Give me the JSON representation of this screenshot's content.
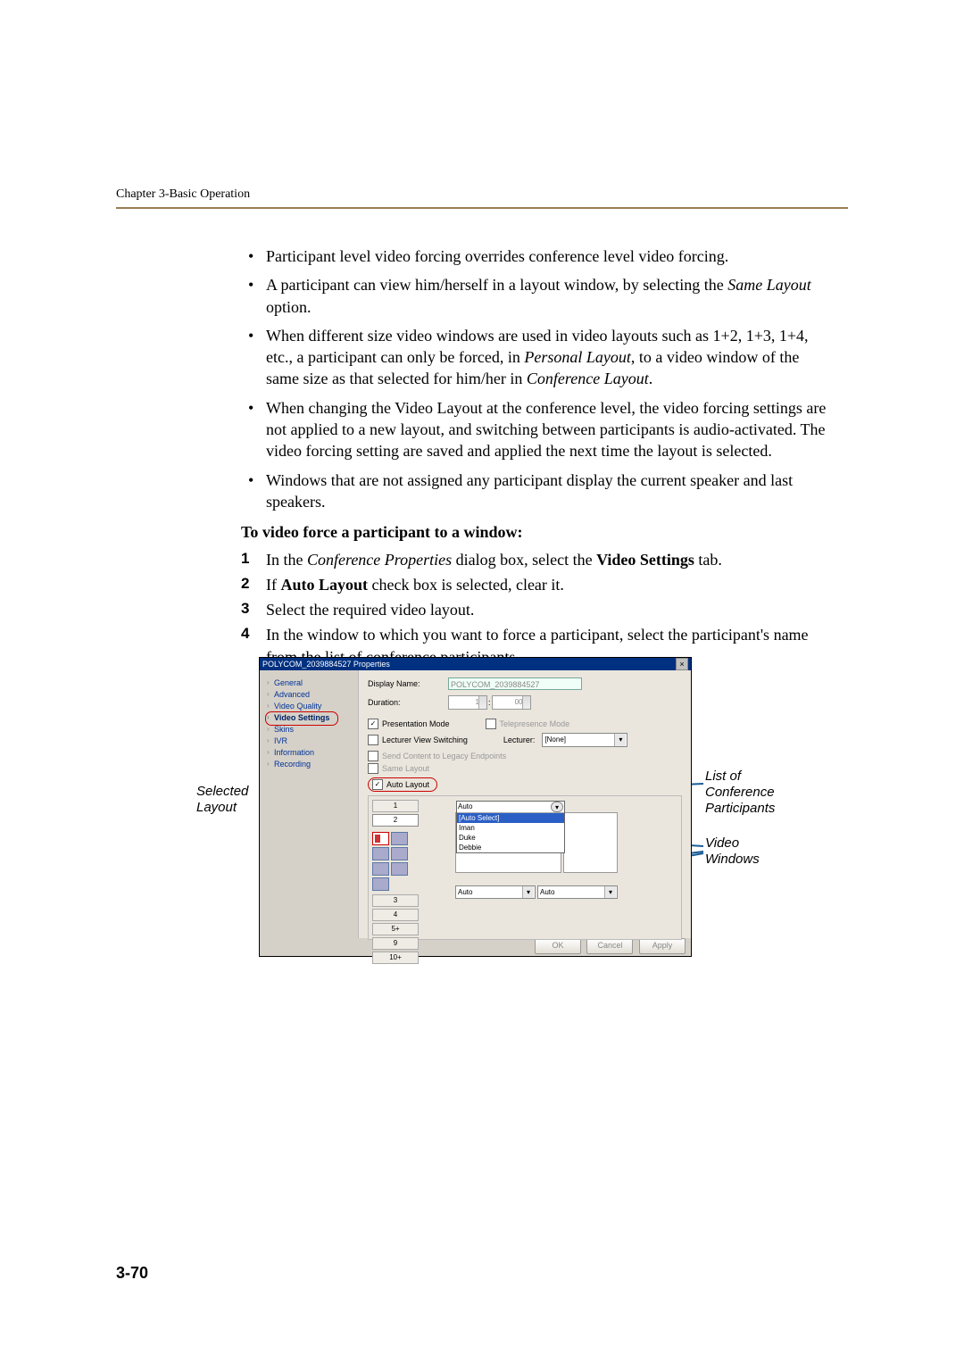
{
  "page": {
    "header": "Chapter 3-Basic Operation",
    "pageNumber": "3-70"
  },
  "bullets": [
    "Participant level video forcing overrides conference level video forcing.",
    "A participant can view him/herself in a layout window, by selecting the <i>Same Layout</i> option.",
    "When different size video windows are used in video layouts such as 1+2, 1+3, 1+4, etc., a participant can only be forced, in <i>Personal Layout</i>, to a video window of the same size as that selected for him/her in <i>Conference Layout</i>.",
    "When changing the Video Layout at the conference level, the video forcing settings are not applied to a new layout, and switching between participants is audio-activated. The video forcing setting are saved and applied the next time the layout is selected.",
    "Windows that are not assigned any participant display the current speaker and last speakers."
  ],
  "instrHeading": "To video force a participant to a window:",
  "steps": [
    "In the <i>Conference Properties</i> dialog box, select the <b>Video Settings</b> tab.",
    "If <b>Auto Layout</b> check box is selected, clear it.",
    "Select the required video layout.",
    "In the window to which you want to force a participant, select the participant's name from the list of conference participants."
  ],
  "dialog": {
    "title": "POLYCOM_2039884527 Properties",
    "sidebar": [
      "General",
      "Advanced",
      "Video Quality",
      "Video Settings",
      "Skins",
      "IVR",
      "Information",
      "Recording"
    ],
    "activeSidebar": "Video Settings",
    "labels": {
      "displayName": "Display Name:",
      "displayNameValue": "POLYCOM_2039884527",
      "duration": "Duration:",
      "dur1": "1",
      "durSep": ":",
      "dur2": "00",
      "presentation": "Presentation Mode",
      "telepresence": "Telepresence Mode",
      "lecturerView": "Lecturer View Switching",
      "lecturer": "Lecturer:",
      "lecturerValue": "[None]",
      "sendContent": "Send Content to Legacy Endpoints",
      "sameLayout": "Same Layout",
      "autoLayout": "Auto Layout"
    },
    "layoutNumbers": [
      "1",
      "2",
      "3",
      "4",
      "5+",
      "9",
      "10+"
    ],
    "dropdown": {
      "head": "Auto",
      "items": [
        "[Auto Select]",
        "Iman",
        "Duke",
        "Debbie"
      ]
    },
    "smallSelect": "Auto",
    "buttons": {
      "ok": "OK",
      "cancel": "Cancel",
      "apply": "Apply"
    }
  },
  "callouts": {
    "selected": "Selected Layout",
    "list": "List of Conference Participants",
    "video": "Video Windows"
  }
}
